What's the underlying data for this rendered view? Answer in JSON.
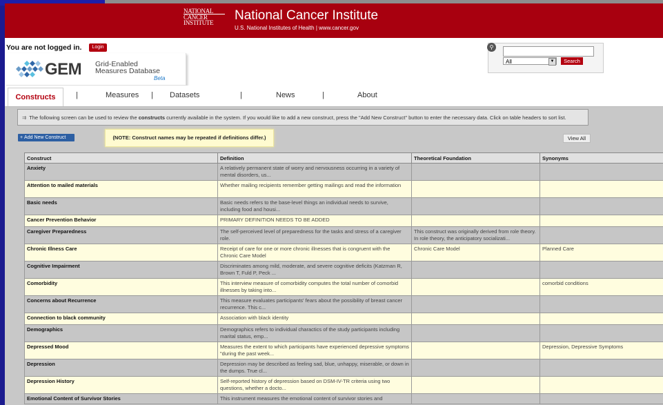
{
  "banner": {
    "logo_lines": [
      "NATIONAL",
      "CANCER",
      "INSTITUTE"
    ],
    "title": "National Cancer Institute",
    "subtitle": "U.S. National Institutes of Health  |  www.cancer.gov"
  },
  "auth": {
    "status": "You are not logged in.",
    "login_label": "Login"
  },
  "gem": {
    "word": "GEM",
    "subtitle_line1": "Grid-Enabled",
    "subtitle_line2": "Measures Database",
    "beta": "Beta"
  },
  "search": {
    "input_value": "",
    "scope": "All",
    "button": "Search"
  },
  "tabs": [
    {
      "label": "Constructs"
    },
    {
      "label": "Measures"
    },
    {
      "label": "Datasets"
    },
    {
      "label": "News"
    },
    {
      "label": "About"
    }
  ],
  "info": {
    "pre": "The following screen can be used to review the ",
    "bold": "constructs",
    "post": " currently available in the system. If you would like to add a new construct, press the \"Add New Construct\" button to enter the necessary data. Click on table headers to sort list."
  },
  "actions": {
    "add_label": "Add New Construct",
    "note": "(NOTE: Construct names may be repeated if definitions differ.)",
    "view_all": "View All"
  },
  "table": {
    "headers": [
      "Construct",
      "Definition",
      "Theoretical Foundation",
      "Synonyms"
    ],
    "rows": [
      [
        "Anxiety",
        "A relatively permanent state of worry and nervousness occurring in a variety of mental disorders, us...",
        "",
        ""
      ],
      [
        "Attention to mailed materials",
        "Whether mailing recipients remember getting mailings and read the information",
        "",
        ""
      ],
      [
        "Basic needs",
        "Basic needs refers to the base-level things an individual needs to survive, including food and housi...",
        "",
        ""
      ],
      [
        "Cancer Prevention Behavior",
        "PRIMARY DEFINITION NEEDS TO BE ADDED",
        "",
        ""
      ],
      [
        "Caregiver Preparedness",
        "The self-perceived level of preparedness for the tasks and stress of a caregiver role.",
        "This construct was originally derived from role theory. In role theory, the anticipatory socializati...",
        ""
      ],
      [
        "Chronic Illness Care",
        "Receipt of care for one or more chronic illnesses that is congruent with the Chronic Care Model",
        "Chronic Care Model",
        "Planned Care"
      ],
      [
        "Cognitive Impairment",
        "Discriminates among mild, moderate, and severe cognitive deficits (Katzman R, Brown T, Fuld P, Peck ...",
        "",
        ""
      ],
      [
        "Comorbidity",
        "This interview measure of comorbidity computes the total number of comorbid illnesses by taking into...",
        "",
        "comorbid conditions"
      ],
      [
        "Concerns about Recurrence",
        "This measure evaluates participants' fears about the possibility of breast cancer recurrence. This c...",
        "",
        ""
      ],
      [
        "Connection to black community",
        "Association with black identity",
        "",
        ""
      ],
      [
        "Demographics",
        "Demographics refers to individual charactics of the study participants including marital status, emp...",
        "",
        ""
      ],
      [
        "Depressed Mood",
        "Measures the extent to which participants have experienced depressive symptoms \"during the past week...",
        "",
        "Depression, Depressive Symptoms"
      ],
      [
        "Depression",
        "Depression may be described as feeling sad, blue, unhappy, miserable, or down in the dumps. True cl...",
        "",
        ""
      ],
      [
        "Depression History",
        "Self-reported history of depression based on DSM-IV-TR criteria using two questions, whether a docto...",
        "",
        ""
      ],
      [
        "Emotional Content of Survivor Stories",
        "This instrument measures the emotional content of survivor stories and",
        "",
        ""
      ]
    ]
  }
}
